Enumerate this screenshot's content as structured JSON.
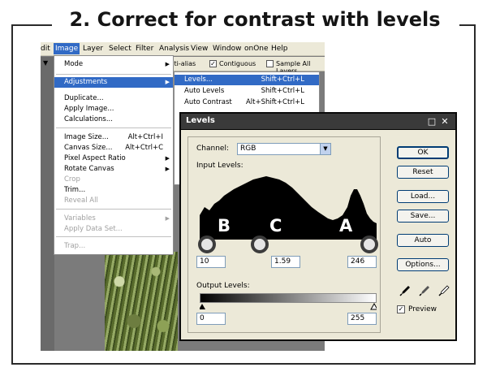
{
  "heading": "2. Correct for contrast with levels",
  "menubar": [
    "dit",
    "Image",
    "Layer",
    "Select",
    "Filter",
    "Analysis",
    "View",
    "Window",
    "onOne",
    "Help"
  ],
  "options_bar": {
    "anti_alias": "Anti-alias",
    "contiguous": "Contiguous",
    "sample_all": "Sample All Layers",
    "checkmark": "✓"
  },
  "image_menu": {
    "items": [
      {
        "label": "Mode",
        "shortcut": "",
        "submenu": true,
        "disabled": false
      },
      {
        "label": "Adjustments",
        "shortcut": "",
        "submenu": true,
        "disabled": false,
        "highlight": true
      },
      {
        "label": "Duplicate...",
        "shortcut": "",
        "submenu": false,
        "disabled": false
      },
      {
        "label": "Apply Image...",
        "shortcut": "",
        "submenu": false,
        "disabled": false
      },
      {
        "label": "Calculations...",
        "shortcut": "",
        "submenu": false,
        "disabled": false
      },
      {
        "label": "Image Size...",
        "shortcut": "Alt+Ctrl+I",
        "submenu": false,
        "disabled": false
      },
      {
        "label": "Canvas Size...",
        "shortcut": "Alt+Ctrl+C",
        "submenu": false,
        "disabled": false
      },
      {
        "label": "Pixel Aspect Ratio",
        "shortcut": "",
        "submenu": true,
        "disabled": false
      },
      {
        "label": "Rotate Canvas",
        "shortcut": "",
        "submenu": true,
        "disabled": false
      },
      {
        "label": "Crop",
        "shortcut": "",
        "submenu": false,
        "disabled": true
      },
      {
        "label": "Trim...",
        "shortcut": "",
        "submenu": false,
        "disabled": false
      },
      {
        "label": "Reveal All",
        "shortcut": "",
        "submenu": false,
        "disabled": true
      },
      {
        "label": "Variables",
        "shortcut": "",
        "submenu": true,
        "disabled": true
      },
      {
        "label": "Apply Data Set...",
        "shortcut": "",
        "submenu": false,
        "disabled": true
      },
      {
        "label": "Trap...",
        "shortcut": "",
        "submenu": false,
        "disabled": true
      }
    ]
  },
  "adjust_menu": {
    "items": [
      {
        "label": "Levels...",
        "shortcut": "Shift+Ctrl+L",
        "highlight": true
      },
      {
        "label": "Auto Levels",
        "shortcut": "Shift+Ctrl+L"
      },
      {
        "label": "Auto Contrast",
        "shortcut": "Alt+Shift+Ctrl+L"
      }
    ]
  },
  "levels": {
    "title": "Levels",
    "channel_label": "Channel:",
    "channel_value": "RGB",
    "input_levels_label": "Input Levels:",
    "input_black": "10",
    "input_gamma": "1.59",
    "input_white": "246",
    "output_levels_label": "Output Levels:",
    "output_black": "0",
    "output_white": "255",
    "buttons": [
      "OK",
      "Reset",
      "Load...",
      "Save...",
      "Auto",
      "Options..."
    ],
    "preview_label": "Preview",
    "preview_checked": true
  },
  "callouts": {
    "b": "B",
    "c": "C",
    "a": "A"
  },
  "icons": {
    "window_max": "□",
    "window_close": "✕",
    "dropdown": "▼"
  }
}
